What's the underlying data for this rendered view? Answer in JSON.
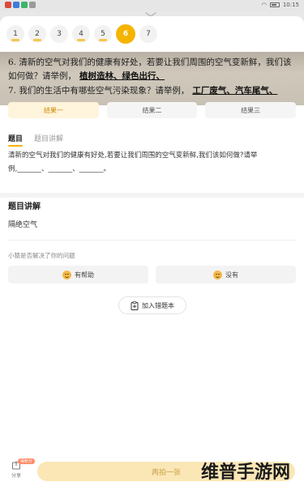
{
  "status_bar": {
    "time": "10:15",
    "app_colors": [
      "#d94a3b",
      "#3b7dd9",
      "#3bb56a",
      "#9a9a9a"
    ]
  },
  "question_nav": [
    {
      "label": "1",
      "state": "done"
    },
    {
      "label": "2",
      "state": "done"
    },
    {
      "label": "3",
      "state": "plain"
    },
    {
      "label": "4",
      "state": "done"
    },
    {
      "label": "5",
      "state": "done"
    },
    {
      "label": "6",
      "state": "active"
    },
    {
      "label": "7",
      "state": "plain"
    }
  ],
  "photo": {
    "line1": "6. 清新的空气对我们的健康有好处，若要让我们周围的空气变新鲜，我们该",
    "line2_print": "如何做？请举例，",
    "line2_hand": "植树造林、绿色出行、",
    "line3_print": "7. 我们的生活中有哪些空气污染现象？请举例，",
    "line3_hand": "工厂废气、汽车尾气、"
  },
  "result_tabs": [
    "结果一",
    "结果二",
    "结果三"
  ],
  "sub_tabs": [
    "题目",
    "题目讲解"
  ],
  "question_text": "清新的空气对我们的健康有好处,若要让我们周围的空气变新鲜,我们该如何做?请举例,_______、_______、_______。",
  "explain": {
    "title": "题目讲解",
    "answer": "隔绝空气"
  },
  "feedback": {
    "question": "小猿是否解决了你的问题",
    "helpful": "有帮助",
    "not_helpful": "没有"
  },
  "add_wrong": "加入错题本",
  "bottom": {
    "share_label": "分享",
    "share_badge": "得积分",
    "retake": "再拍一张"
  },
  "watermark": "维普手游网",
  "colors": {
    "accent": "#f5b400",
    "retake_bg": "#fbe7b6",
    "tab_active_bg": "#fff4dc"
  }
}
